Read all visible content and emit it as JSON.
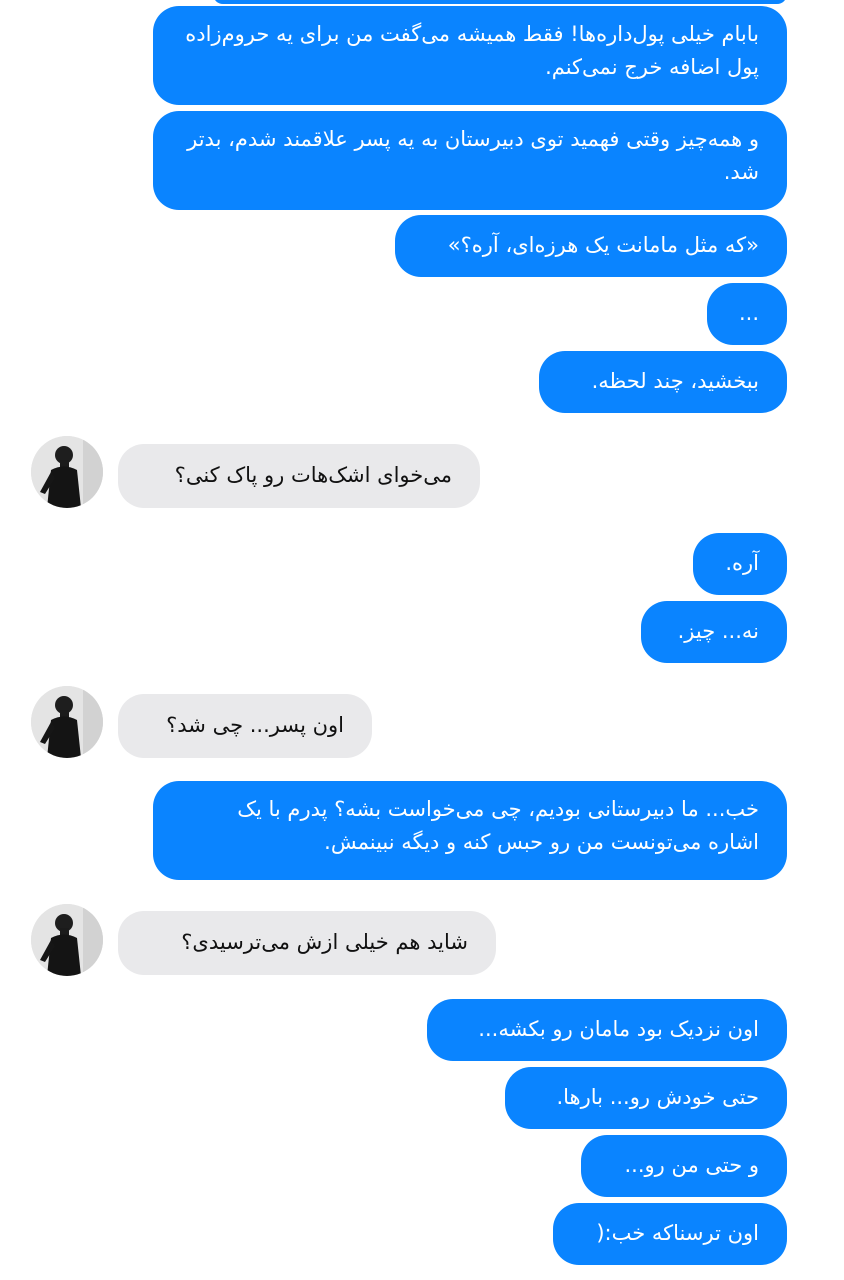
{
  "colors": {
    "outgoing_bubble": "#0a84ff",
    "incoming_bubble": "#e9e9eb",
    "background": "#ffffff"
  },
  "avatar": {
    "icon": "person-in-black-turtleneck-avatar"
  },
  "messages": [
    {
      "from": "me",
      "text": "بابام خیلی پول‌داره‌ها! فقط همیشه می‌گفت من برای یه حروم‌زاده پول اضافه خرج نمی‌کنم."
    },
    {
      "from": "me",
      "text": "و همه‌چیز وقتی فهمید توی دبیرستان به یه پسر علاقمند شدم، بدتر شد."
    },
    {
      "from": "me",
      "text": "«که مثل مامانت یک هرزه‌ای، آره؟»"
    },
    {
      "from": "me",
      "text": "..."
    },
    {
      "from": "me",
      "text": "ببخشید، چند لحظه."
    },
    {
      "from": "them",
      "text": "می‌خوای اشک‌هات رو پاک کنی؟"
    },
    {
      "from": "me",
      "text": "آره."
    },
    {
      "from": "me",
      "text": "نه... چیز."
    },
    {
      "from": "them",
      "text": "اون پسر... چی شد؟"
    },
    {
      "from": "me",
      "text": "خب... ما دبیرستانی بودیم، چی می‌خواست بشه؟ پدرم با یک اشاره می‌تونست من رو حبس کنه و دیگه نبینمش."
    },
    {
      "from": "them",
      "text": "شاید هم خیلی ازش می‌ترسیدی؟"
    },
    {
      "from": "me",
      "text": "اون نزدیک بود مامان رو بکشه..."
    },
    {
      "from": "me",
      "text": "حتی خودش رو... بارها."
    },
    {
      "from": "me",
      "text": "و حتی من رو..."
    },
    {
      "from": "me",
      "text": "اون ترسناکه خب:("
    }
  ]
}
